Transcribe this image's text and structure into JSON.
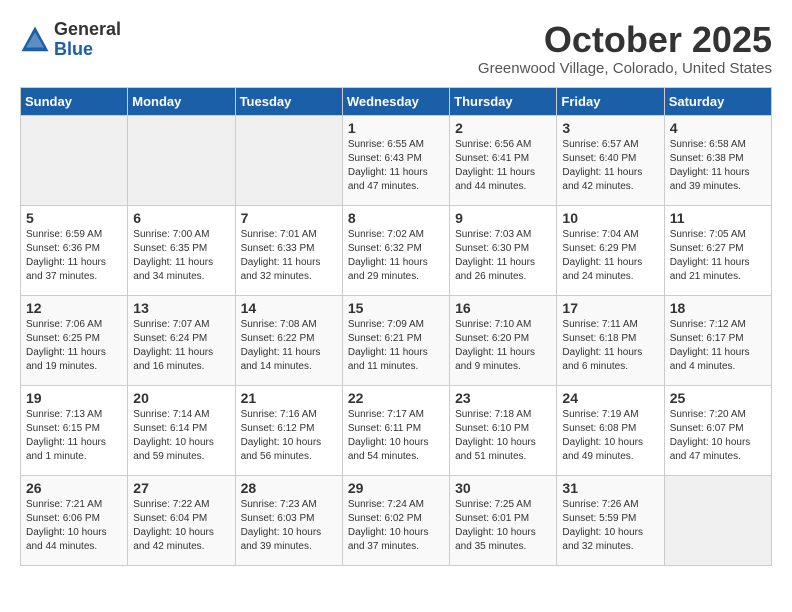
{
  "header": {
    "logo_general": "General",
    "logo_blue": "Blue",
    "month_title": "October 2025",
    "location": "Greenwood Village, Colorado, United States"
  },
  "days_of_week": [
    "Sunday",
    "Monday",
    "Tuesday",
    "Wednesday",
    "Thursday",
    "Friday",
    "Saturday"
  ],
  "weeks": [
    [
      {
        "day": "",
        "info": ""
      },
      {
        "day": "",
        "info": ""
      },
      {
        "day": "",
        "info": ""
      },
      {
        "day": "1",
        "info": "Sunrise: 6:55 AM\nSunset: 6:43 PM\nDaylight: 11 hours and 47 minutes."
      },
      {
        "day": "2",
        "info": "Sunrise: 6:56 AM\nSunset: 6:41 PM\nDaylight: 11 hours and 44 minutes."
      },
      {
        "day": "3",
        "info": "Sunrise: 6:57 AM\nSunset: 6:40 PM\nDaylight: 11 hours and 42 minutes."
      },
      {
        "day": "4",
        "info": "Sunrise: 6:58 AM\nSunset: 6:38 PM\nDaylight: 11 hours and 39 minutes."
      }
    ],
    [
      {
        "day": "5",
        "info": "Sunrise: 6:59 AM\nSunset: 6:36 PM\nDaylight: 11 hours and 37 minutes."
      },
      {
        "day": "6",
        "info": "Sunrise: 7:00 AM\nSunset: 6:35 PM\nDaylight: 11 hours and 34 minutes."
      },
      {
        "day": "7",
        "info": "Sunrise: 7:01 AM\nSunset: 6:33 PM\nDaylight: 11 hours and 32 minutes."
      },
      {
        "day": "8",
        "info": "Sunrise: 7:02 AM\nSunset: 6:32 PM\nDaylight: 11 hours and 29 minutes."
      },
      {
        "day": "9",
        "info": "Sunrise: 7:03 AM\nSunset: 6:30 PM\nDaylight: 11 hours and 26 minutes."
      },
      {
        "day": "10",
        "info": "Sunrise: 7:04 AM\nSunset: 6:29 PM\nDaylight: 11 hours and 24 minutes."
      },
      {
        "day": "11",
        "info": "Sunrise: 7:05 AM\nSunset: 6:27 PM\nDaylight: 11 hours and 21 minutes."
      }
    ],
    [
      {
        "day": "12",
        "info": "Sunrise: 7:06 AM\nSunset: 6:25 PM\nDaylight: 11 hours and 19 minutes."
      },
      {
        "day": "13",
        "info": "Sunrise: 7:07 AM\nSunset: 6:24 PM\nDaylight: 11 hours and 16 minutes."
      },
      {
        "day": "14",
        "info": "Sunrise: 7:08 AM\nSunset: 6:22 PM\nDaylight: 11 hours and 14 minutes."
      },
      {
        "day": "15",
        "info": "Sunrise: 7:09 AM\nSunset: 6:21 PM\nDaylight: 11 hours and 11 minutes."
      },
      {
        "day": "16",
        "info": "Sunrise: 7:10 AM\nSunset: 6:20 PM\nDaylight: 11 hours and 9 minutes."
      },
      {
        "day": "17",
        "info": "Sunrise: 7:11 AM\nSunset: 6:18 PM\nDaylight: 11 hours and 6 minutes."
      },
      {
        "day": "18",
        "info": "Sunrise: 7:12 AM\nSunset: 6:17 PM\nDaylight: 11 hours and 4 minutes."
      }
    ],
    [
      {
        "day": "19",
        "info": "Sunrise: 7:13 AM\nSunset: 6:15 PM\nDaylight: 11 hours and 1 minute."
      },
      {
        "day": "20",
        "info": "Sunrise: 7:14 AM\nSunset: 6:14 PM\nDaylight: 10 hours and 59 minutes."
      },
      {
        "day": "21",
        "info": "Sunrise: 7:16 AM\nSunset: 6:12 PM\nDaylight: 10 hours and 56 minutes."
      },
      {
        "day": "22",
        "info": "Sunrise: 7:17 AM\nSunset: 6:11 PM\nDaylight: 10 hours and 54 minutes."
      },
      {
        "day": "23",
        "info": "Sunrise: 7:18 AM\nSunset: 6:10 PM\nDaylight: 10 hours and 51 minutes."
      },
      {
        "day": "24",
        "info": "Sunrise: 7:19 AM\nSunset: 6:08 PM\nDaylight: 10 hours and 49 minutes."
      },
      {
        "day": "25",
        "info": "Sunrise: 7:20 AM\nSunset: 6:07 PM\nDaylight: 10 hours and 47 minutes."
      }
    ],
    [
      {
        "day": "26",
        "info": "Sunrise: 7:21 AM\nSunset: 6:06 PM\nDaylight: 10 hours and 44 minutes."
      },
      {
        "day": "27",
        "info": "Sunrise: 7:22 AM\nSunset: 6:04 PM\nDaylight: 10 hours and 42 minutes."
      },
      {
        "day": "28",
        "info": "Sunrise: 7:23 AM\nSunset: 6:03 PM\nDaylight: 10 hours and 39 minutes."
      },
      {
        "day": "29",
        "info": "Sunrise: 7:24 AM\nSunset: 6:02 PM\nDaylight: 10 hours and 37 minutes."
      },
      {
        "day": "30",
        "info": "Sunrise: 7:25 AM\nSunset: 6:01 PM\nDaylight: 10 hours and 35 minutes."
      },
      {
        "day": "31",
        "info": "Sunrise: 7:26 AM\nSunset: 5:59 PM\nDaylight: 10 hours and 32 minutes."
      },
      {
        "day": "",
        "info": ""
      }
    ]
  ]
}
